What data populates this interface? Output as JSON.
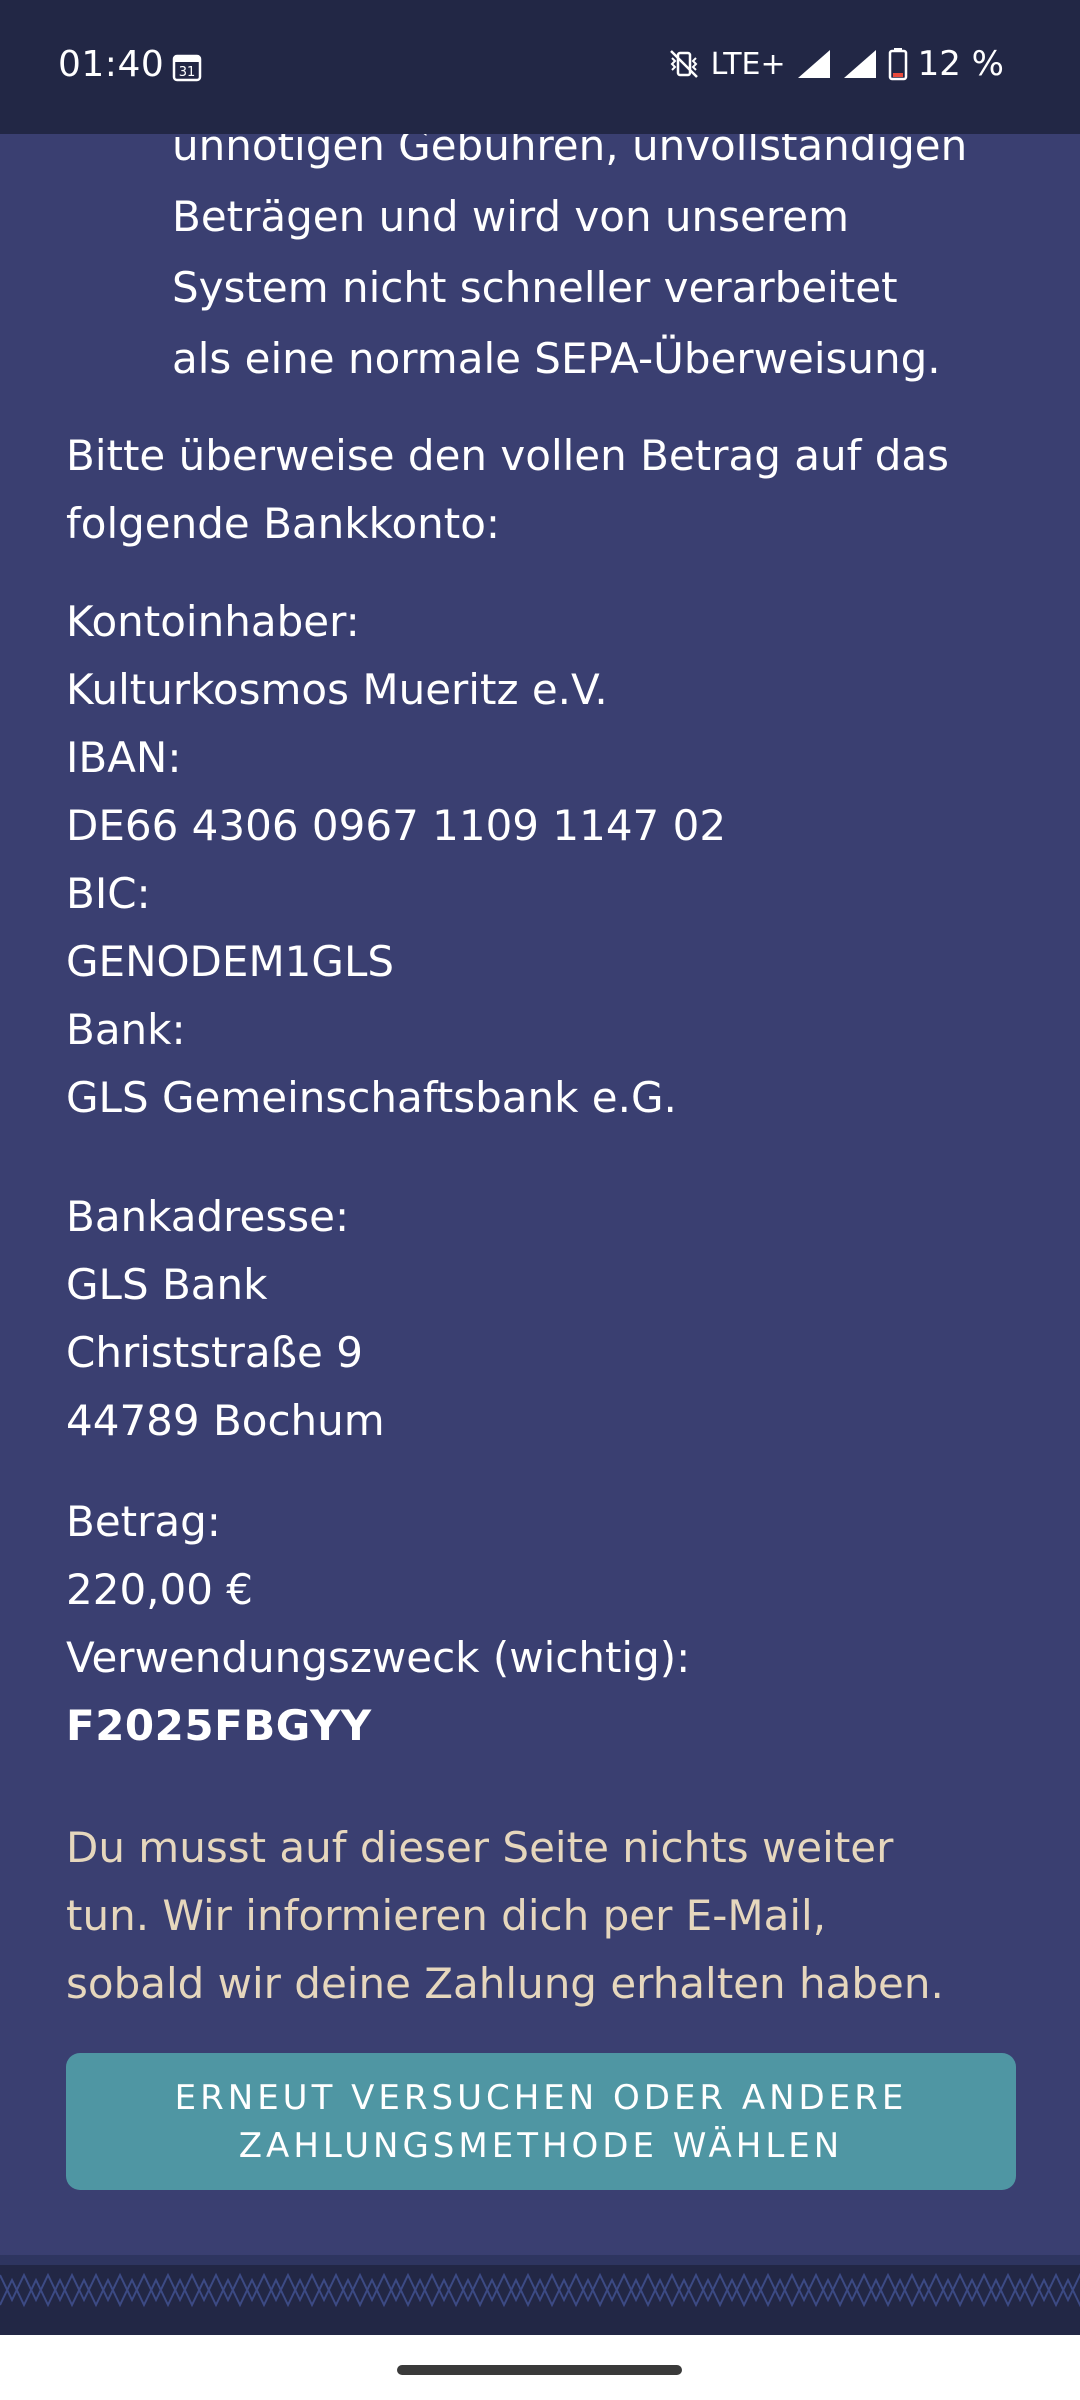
{
  "status_bar": {
    "time": "01:40",
    "calendar_day": "31",
    "network": "LTE+",
    "battery": "12 %"
  },
  "content": {
    "warning_lines": [
      "unnötigen Gebühren, unvollständigen",
      "Beträgen und wird von unserem",
      "System nicht schneller verarbeitet",
      "als eine normale SEPA-Überweisung."
    ],
    "intro_lines": [
      "Bitte überweise den vollen Betrag auf das",
      "folgende Bankkonto:"
    ],
    "account_holder_label": "Kontoinhaber:",
    "account_holder": "Kulturkosmos Mueritz e.V.",
    "iban_label": "IBAN:",
    "iban": "DE66 4306 0967 1109 1147 02",
    "bic_label": "BIC:",
    "bic": "GENODEM1GLS",
    "bank_label": "Bank:",
    "bank": "GLS Gemeinschaftsbank e.G.",
    "bank_address_label": "Bankadresse:",
    "bank_address": [
      "GLS Bank",
      "Christstraße 9",
      "44789 Bochum"
    ],
    "amount_label": "Betrag:",
    "amount": "220,00 €",
    "reference_label": "Verwendungszweck (wichtig):",
    "reference": "F2025FBGYY",
    "notice_lines": [
      "Du musst auf dieser Seite nichts weiter",
      "tun. Wir informieren dich per E-Mail,",
      "sobald wir deine Zahlung erhalten haben."
    ],
    "retry_button_lines": [
      "ERNEUT VERSUCHEN ODER ANDERE",
      "ZAHLUNGSMETHODE WÄHLEN"
    ]
  },
  "colors": {
    "background": "#3a3f71",
    "status_bar": "#222745",
    "notice_text": "#e6d7bd",
    "button": "#4f96a3"
  }
}
